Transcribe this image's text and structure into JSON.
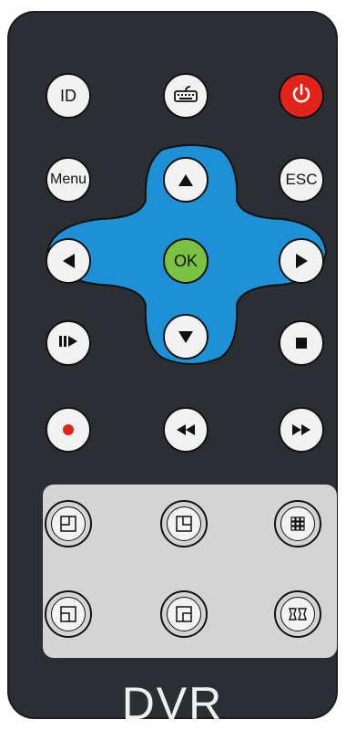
{
  "remote": {
    "brand": "DVR",
    "colors": {
      "body": "#2b2f33",
      "dpad": "#1e90d6",
      "power": "#e2231a",
      "ok": "#7cc242",
      "record": "#e2231a"
    }
  },
  "buttons": {
    "id_label": "ID",
    "keyboard_icon": "keyboard-icon",
    "power_icon": "power-icon",
    "menu_label": "Menu",
    "esc_label": "ESC",
    "ok_label": "OK",
    "up_icon": "arrow-up-icon",
    "down_icon": "arrow-down-icon",
    "left_icon": "arrow-left-icon",
    "right_icon": "arrow-right-icon",
    "play_pause_icon": "play-pause-icon",
    "stop_icon": "stop-icon",
    "record_icon": "record-icon",
    "rewind_icon": "rewind-icon",
    "fast_forward_icon": "fast-forward-icon"
  },
  "split_screen": {
    "items": [
      {
        "icon": "quad-top-left-icon"
      },
      {
        "icon": "quad-top-right-icon"
      },
      {
        "icon": "grid-9-icon"
      },
      {
        "icon": "quad-bottom-left-icon"
      },
      {
        "icon": "quad-bottom-right-icon"
      },
      {
        "icon": "sequence-icon"
      }
    ]
  }
}
